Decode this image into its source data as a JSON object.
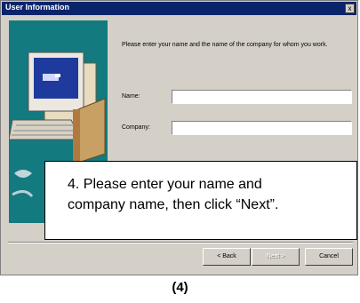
{
  "window": {
    "title": "User Information",
    "close_label": "x"
  },
  "dialog": {
    "instruction": "Please enter your name and the name of the company for whom you work.",
    "name_label": "Name:",
    "name_value": "",
    "company_label": "Company:",
    "company_value": ""
  },
  "buttons": {
    "back": "< Back",
    "next": "Next >",
    "cancel": "Cancel"
  },
  "callout": {
    "line1": "4. Please enter your name and",
    "line2": "company name, then click “Next”."
  },
  "caption": "(4)",
  "colors": {
    "title_bar": "#0a246a",
    "dialog_face": "#d4d0c8",
    "art_background": "#137a80"
  },
  "icons": [
    "computer-illustration-icon",
    "close-icon"
  ]
}
